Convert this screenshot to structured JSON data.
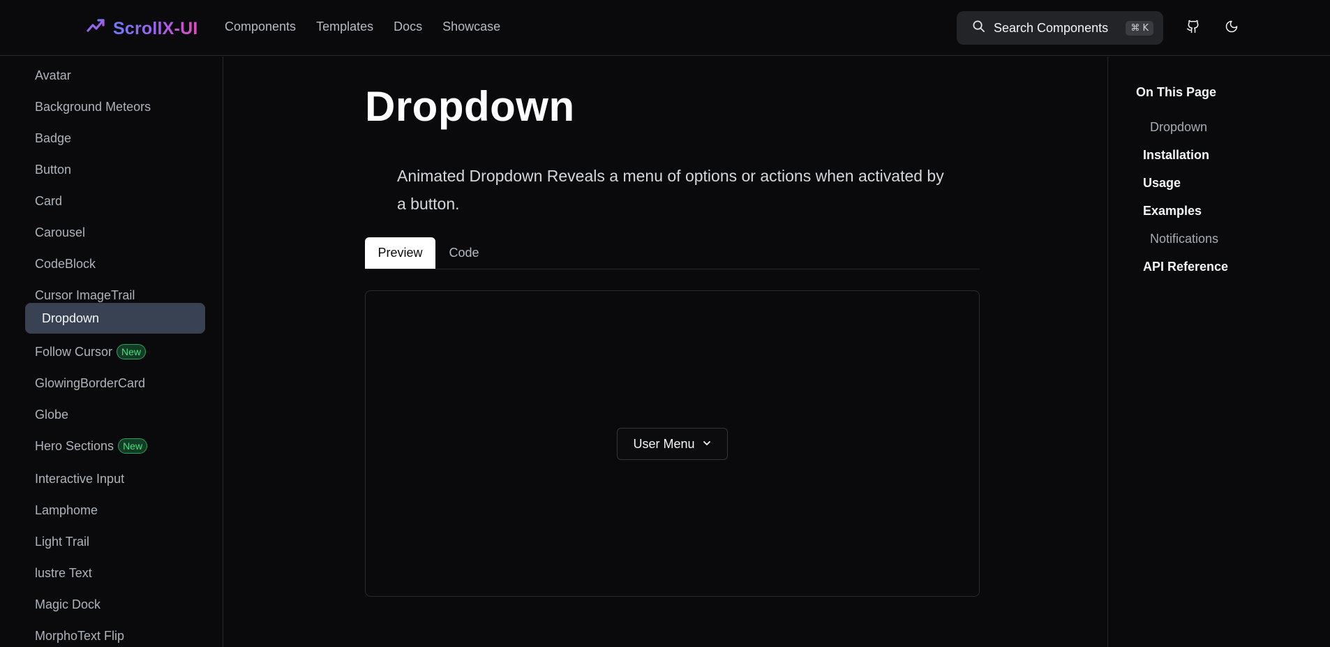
{
  "header": {
    "brand": "ScrollX-UI",
    "nav": [
      "Components",
      "Templates",
      "Docs",
      "Showcase"
    ],
    "search_label": "Search Components",
    "search_shortcut": "⌘ K"
  },
  "sidebar": {
    "items": [
      {
        "label": "Avatar"
      },
      {
        "label": "Background Meteors"
      },
      {
        "label": "Badge"
      },
      {
        "label": "Button"
      },
      {
        "label": "Card"
      },
      {
        "label": "Carousel"
      },
      {
        "label": "CodeBlock"
      },
      {
        "label": "Cursor ImageTrail"
      },
      {
        "label": "Dropdown",
        "active": true
      },
      {
        "label": "Follow Cursor",
        "badge": "New"
      },
      {
        "label": "GlowingBorderCard"
      },
      {
        "label": "Globe"
      },
      {
        "label": "Hero Sections",
        "badge": "New"
      },
      {
        "label": "Interactive Input"
      },
      {
        "label": "Lamphome"
      },
      {
        "label": "Light Trail"
      },
      {
        "label": "lustre Text"
      },
      {
        "label": "Magic Dock"
      },
      {
        "label": "MorphoText Flip"
      }
    ]
  },
  "main": {
    "title": "Dropdown",
    "description": "Animated Dropdown Reveals a menu of options or actions when activated by a button.",
    "tabs": [
      "Preview",
      "Code"
    ],
    "preview_button": "User Menu"
  },
  "toc": {
    "heading": "On This Page",
    "items": [
      {
        "label": "Dropdown",
        "level": 2
      },
      {
        "label": "Installation",
        "level": 1
      },
      {
        "label": "Usage",
        "level": 1
      },
      {
        "label": "Examples",
        "level": 1
      },
      {
        "label": "Notifications",
        "level": 2
      },
      {
        "label": "API Reference",
        "level": 1
      }
    ]
  }
}
